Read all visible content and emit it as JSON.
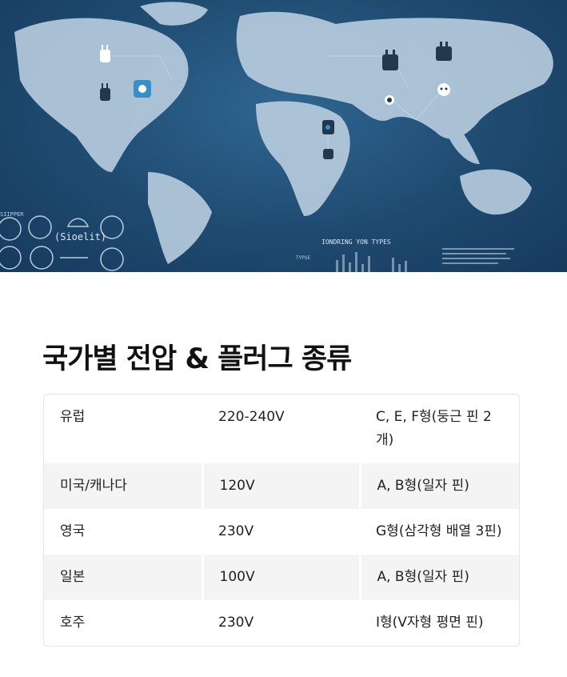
{
  "hero": {
    "image_alt": "world map with plug icons",
    "map_labels": {
      "left_panel_top": "SIIPPER",
      "left_panel_brand": "(Sioelit)",
      "bottom_center": "IONDRING YON  TYPES",
      "bottom_small": "TYPSE"
    },
    "colors": {
      "ocean": "#1f4a70",
      "land": "#b9cde0",
      "icon": "#24384d"
    }
  },
  "section": {
    "title": "국가별 전압 & 플러그 종류"
  },
  "table": {
    "rows": [
      {
        "region": "유럽",
        "voltage": "220-240V",
        "plug": "C, E, F형(둥근 핀 2개)"
      },
      {
        "region": "미국/캐나다",
        "voltage": "120V",
        "plug": "A, B형(일자 핀)"
      },
      {
        "region": "영국",
        "voltage": "230V",
        "plug": "G형(삼각형 배열 3핀)"
      },
      {
        "region": "일본",
        "voltage": "100V",
        "plug": "A, B형(일자 핀)"
      },
      {
        "region": "호주",
        "voltage": "230V",
        "plug": "I형(V자형 평면 핀)"
      }
    ]
  }
}
